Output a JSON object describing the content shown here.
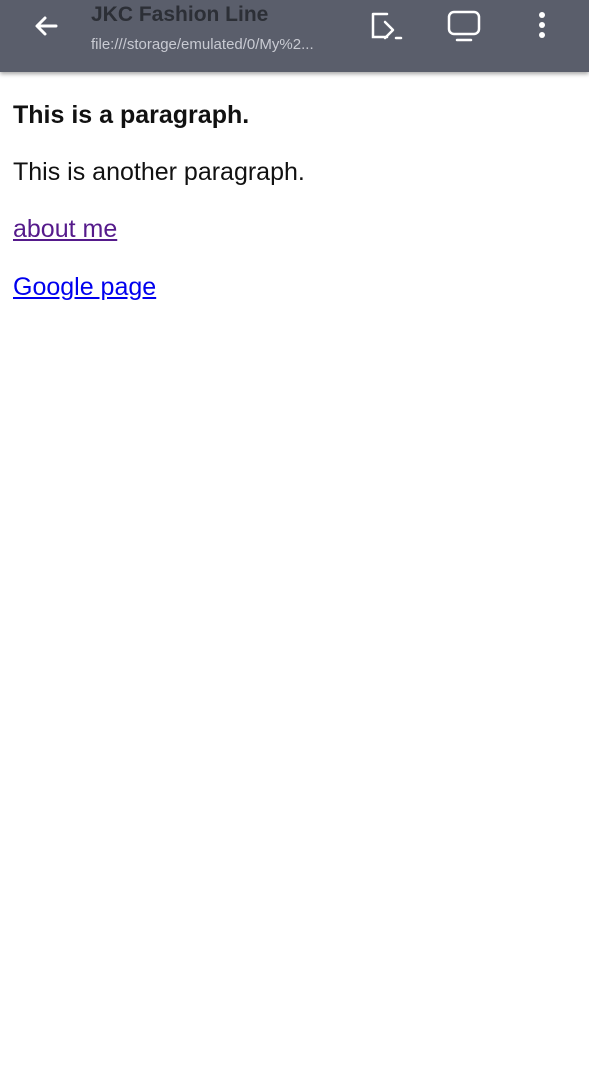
{
  "toolbar": {
    "back_icon": "arrow-left-icon",
    "title": "JKC Fashion Line",
    "url": "file:///storage/emulated/0/My%2...",
    "icons": [
      "open-with-icon",
      "tv-icon",
      "more-vert-icon"
    ],
    "background_color": "#5a5e6b"
  },
  "content": {
    "paragraph_bold": "This is a paragraph.",
    "paragraph": "This is another paragraph.",
    "link_about": "about me",
    "link_google": "Google page",
    "visited_link_color": "#551a8b",
    "link_color": "#0000ee"
  }
}
